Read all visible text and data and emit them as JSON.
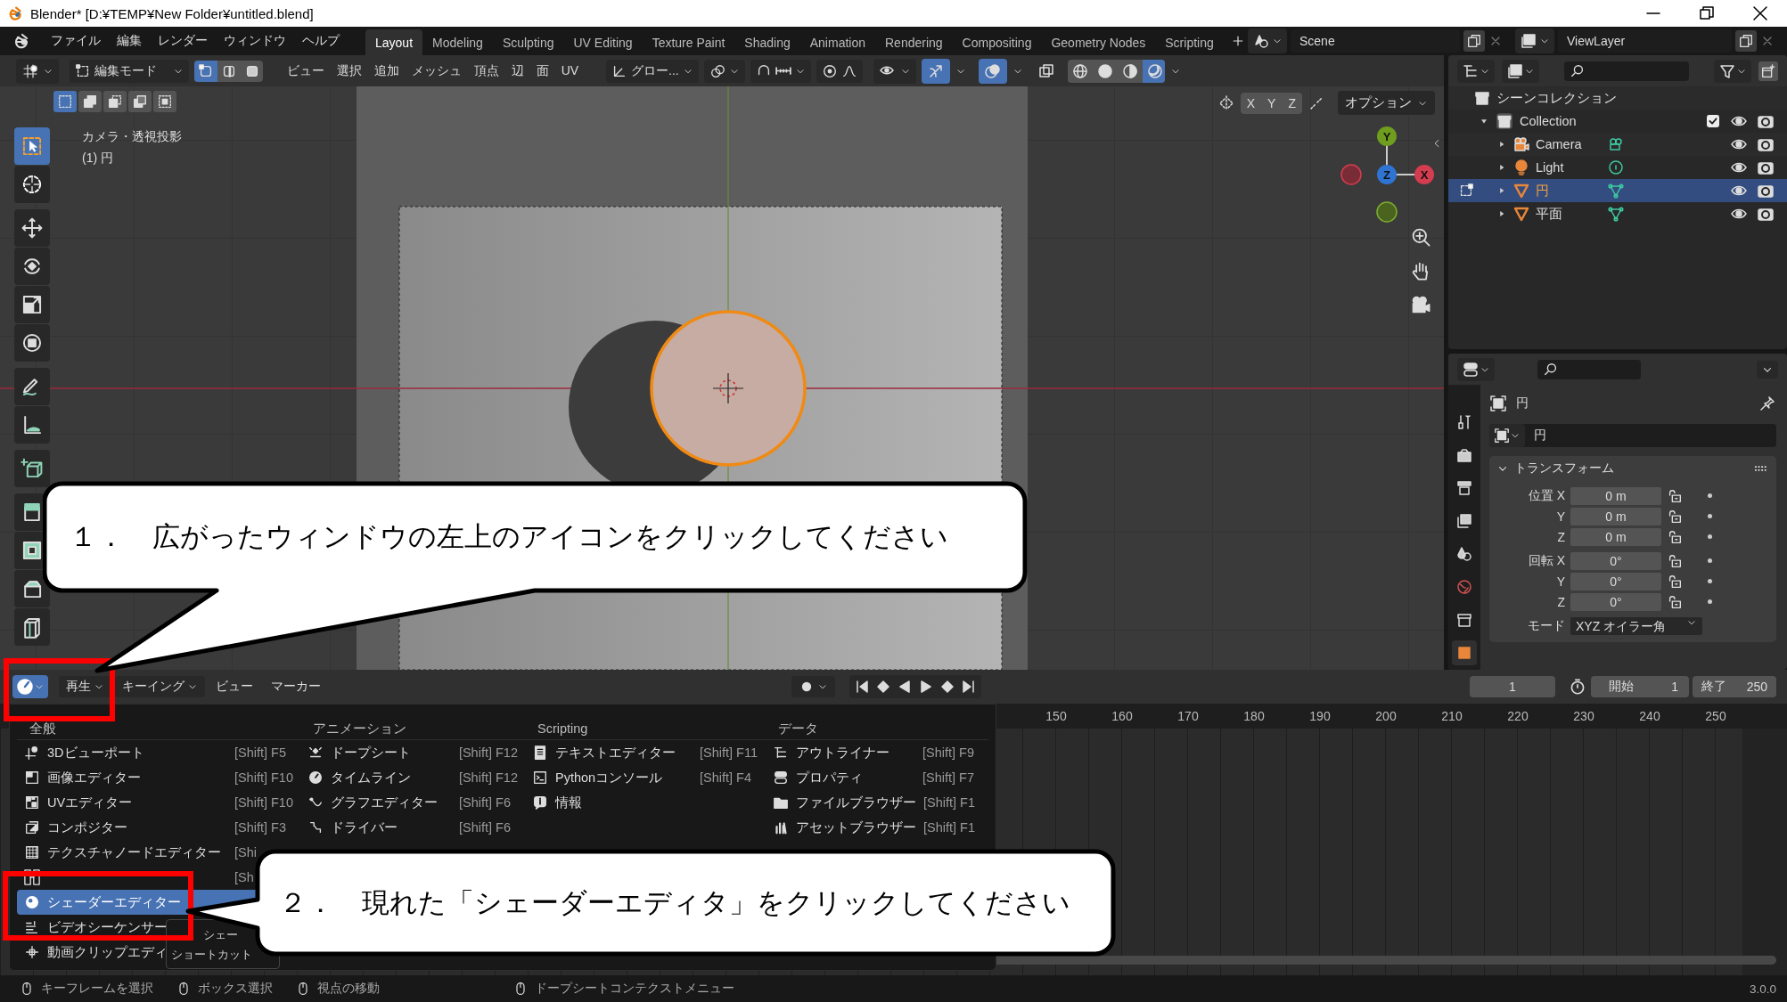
{
  "window": {
    "title": "Blender* [D:¥TEMP¥New Folder¥untitled.blend]"
  },
  "top_menus": [
    "ファイル",
    "編集",
    "レンダー",
    "ウィンドウ",
    "ヘルプ"
  ],
  "workspaces": [
    {
      "label": "Layout",
      "selected": true
    },
    {
      "label": "Modeling",
      "selected": false
    },
    {
      "label": "Sculpting",
      "selected": false
    },
    {
      "label": "UV Editing",
      "selected": false
    },
    {
      "label": "Texture Paint",
      "selected": false
    },
    {
      "label": "Shading",
      "selected": false
    },
    {
      "label": "Animation",
      "selected": false
    },
    {
      "label": "Rendering",
      "selected": false
    },
    {
      "label": "Compositing",
      "selected": false
    },
    {
      "label": "Geometry Nodes",
      "selected": false
    },
    {
      "label": "Scripting",
      "selected": false
    }
  ],
  "scene": {
    "name": "Scene"
  },
  "view_layer": {
    "name": "ViewLayer"
  },
  "viewport": {
    "mode": "編集モード",
    "select_modes": [
      {
        "kind": "vertex",
        "selected": true
      },
      {
        "kind": "edge",
        "selected": false
      },
      {
        "kind": "face",
        "selected": false
      }
    ],
    "menus": [
      "ビュー",
      "選択",
      "追加",
      "メッシュ",
      "頂点",
      "辺",
      "面",
      "UV"
    ],
    "orientation": "グロー...",
    "shading": [
      {
        "kind": "wireframe",
        "selected": false
      },
      {
        "kind": "solid",
        "selected": false
      },
      {
        "kind": "material",
        "selected": false
      },
      {
        "kind": "rendered",
        "selected": true
      }
    ],
    "axis_buttons": [
      "X",
      "Y",
      "Z"
    ],
    "options": "オプション",
    "overlay_text": [
      "カメラ・透視投影",
      "(1) 円"
    ],
    "gizmo_labels": [
      "Y",
      "Z",
      "X"
    ],
    "tools": [
      {
        "kind": "select",
        "selected": true
      },
      {
        "kind": "cursor",
        "selected": false
      },
      {
        "kind": "move",
        "selected": false
      },
      {
        "kind": "rotate",
        "selected": false
      },
      {
        "kind": "scale",
        "selected": false
      },
      {
        "kind": "transform",
        "selected": false
      },
      {
        "kind": "annotate",
        "selected": false
      },
      {
        "kind": "measure",
        "selected": false
      },
      {
        "kind": "add_cube",
        "selected": false
      },
      {
        "kind": "extrude",
        "selected": false
      },
      {
        "kind": "inset",
        "selected": false
      },
      {
        "kind": "bevel",
        "selected": false
      },
      {
        "kind": "loopcut",
        "selected": false
      }
    ]
  },
  "outliner": {
    "root": "シーンコレクション",
    "collections": [
      {
        "name": "Collection",
        "checked": true,
        "expanded": true,
        "children": [
          {
            "name": "Camera",
            "kind": "camera",
            "selected": false
          },
          {
            "name": "Light",
            "kind": "light",
            "selected": false
          },
          {
            "name": "円",
            "kind": "mesh",
            "selected": true
          },
          {
            "name": "平面",
            "kind": "mesh",
            "selected": false
          }
        ]
      }
    ]
  },
  "properties": {
    "tabs": [
      {
        "kind": "tool",
        "selected": false
      },
      {
        "kind": "render",
        "selected": false
      },
      {
        "kind": "output",
        "selected": false
      },
      {
        "kind": "view_layer",
        "selected": false
      },
      {
        "kind": "scene",
        "selected": false
      },
      {
        "kind": "world",
        "selected": false
      },
      {
        "kind": "collection",
        "selected": false
      },
      {
        "kind": "object",
        "selected": true
      }
    ],
    "object": "円",
    "datablock": "円",
    "panel": {
      "title": "トランスフォーム",
      "expanded": true,
      "groups": [
        {
          "label": "位置",
          "rows": [
            {
              "axis": "X",
              "value": "0 m"
            },
            {
              "axis": "Y",
              "value": "0 m"
            },
            {
              "axis": "Z",
              "value": "0 m"
            }
          ]
        },
        {
          "label": "回転",
          "rows": [
            {
              "axis": "X",
              "value": "0°"
            },
            {
              "axis": "Y",
              "value": "0°"
            },
            {
              "axis": "Z",
              "value": "0°"
            }
          ]
        }
      ],
      "mode_row": {
        "label": "モード",
        "value": "XYZ オイラー角"
      }
    }
  },
  "timeline": {
    "menus": [
      {
        "label": "再生",
        "dropdown": true
      },
      {
        "label": "キーイング",
        "dropdown": true
      },
      {
        "label": "ビュー",
        "dropdown": false
      },
      {
        "label": "マーカー",
        "dropdown": false
      }
    ],
    "current_frame": "1",
    "start": {
      "label": "開始",
      "value": "1"
    },
    "end": {
      "label": "終了",
      "value": "250"
    },
    "ruler": [
      "150",
      "160",
      "170",
      "180",
      "190",
      "200",
      "210",
      "220",
      "230",
      "240",
      "250"
    ]
  },
  "editor_menu": {
    "columns": [
      {
        "heading": "全般",
        "items": [
          {
            "label": "3Dビューポート",
            "shortcut": "[Shift] F5",
            "kind": "viewport3d",
            "selected": false
          },
          {
            "label": "画像エディター",
            "shortcut": "[Shift] F10",
            "kind": "image",
            "selected": false
          },
          {
            "label": "UVエディター",
            "shortcut": "[Shift] F10",
            "kind": "uv",
            "selected": false
          },
          {
            "label": "コンポジター",
            "shortcut": "[Shift] F3",
            "kind": "compositor",
            "selected": false
          },
          {
            "label": "テクスチャノードエディター",
            "shortcut": "[Shi",
            "kind": "texture_node",
            "selected": false
          },
          {
            "shortcut": "[Sh",
            "kind": "geometry_node",
            "selected": false
          },
          {
            "label": "シェーダーエディター",
            "kind": "shader",
            "selected": true
          },
          {
            "label": "ビデオシーケンサー",
            "kind": "sequencer",
            "selected": false
          },
          {
            "label": "動画クリップエディ",
            "kind": "clip",
            "selected": false
          }
        ]
      },
      {
        "heading": "アニメーション",
        "items": [
          {
            "label": "ドープシート",
            "shortcut": "[Shift] F12",
            "kind": "dopesheet",
            "selected": false
          },
          {
            "label": "タイムライン",
            "shortcut": "[Shift] F12",
            "kind": "timeline",
            "selected": false
          },
          {
            "label": "グラフエディター",
            "shortcut": "[Shift] F6",
            "kind": "graph",
            "selected": false
          },
          {
            "label": "ドライバー",
            "shortcut": "[Shift] F6",
            "kind": "drivers",
            "selected": false
          }
        ]
      },
      {
        "heading": "Scripting",
        "items": [
          {
            "label": "テキストエディター",
            "shortcut": "[Shift] F11",
            "kind": "text",
            "selected": false
          },
          {
            "label": "Pythonコンソール",
            "shortcut": "[Shift] F4",
            "kind": "console",
            "selected": false
          },
          {
            "label": "情報",
            "kind": "info",
            "selected": false
          }
        ]
      },
      {
        "heading": "データ",
        "items": [
          {
            "label": "アウトライナー",
            "shortcut": "[Shift] F9",
            "kind": "outliner",
            "selected": false
          },
          {
            "label": "プロパティ",
            "shortcut": "[Shift] F7",
            "kind": "properties",
            "selected": false
          },
          {
            "label": "ファイルブラウザー",
            "shortcut": "[Shift] F1",
            "kind": "file_browser",
            "selected": false
          },
          {
            "label": "アセットブラウザー",
            "shortcut": "[Shift] F1",
            "kind": "asset_browser",
            "selected": false
          }
        ]
      }
    ]
  },
  "tooltip": [
    "シェー",
    "ショートカット"
  ],
  "status_bar": {
    "hints": [
      "キーフレームを選択",
      "ボックス選択",
      "視点の移動",
      "ドープシートコンテクストメニュー"
    ],
    "version": "3.0.0"
  },
  "callouts": [
    {
      "text": "１．　広がったウィンドウの左上のアイコンをクリックしてください"
    },
    {
      "text": "２．　現れた「シェーダーエディタ」をクリックしてください"
    }
  ]
}
